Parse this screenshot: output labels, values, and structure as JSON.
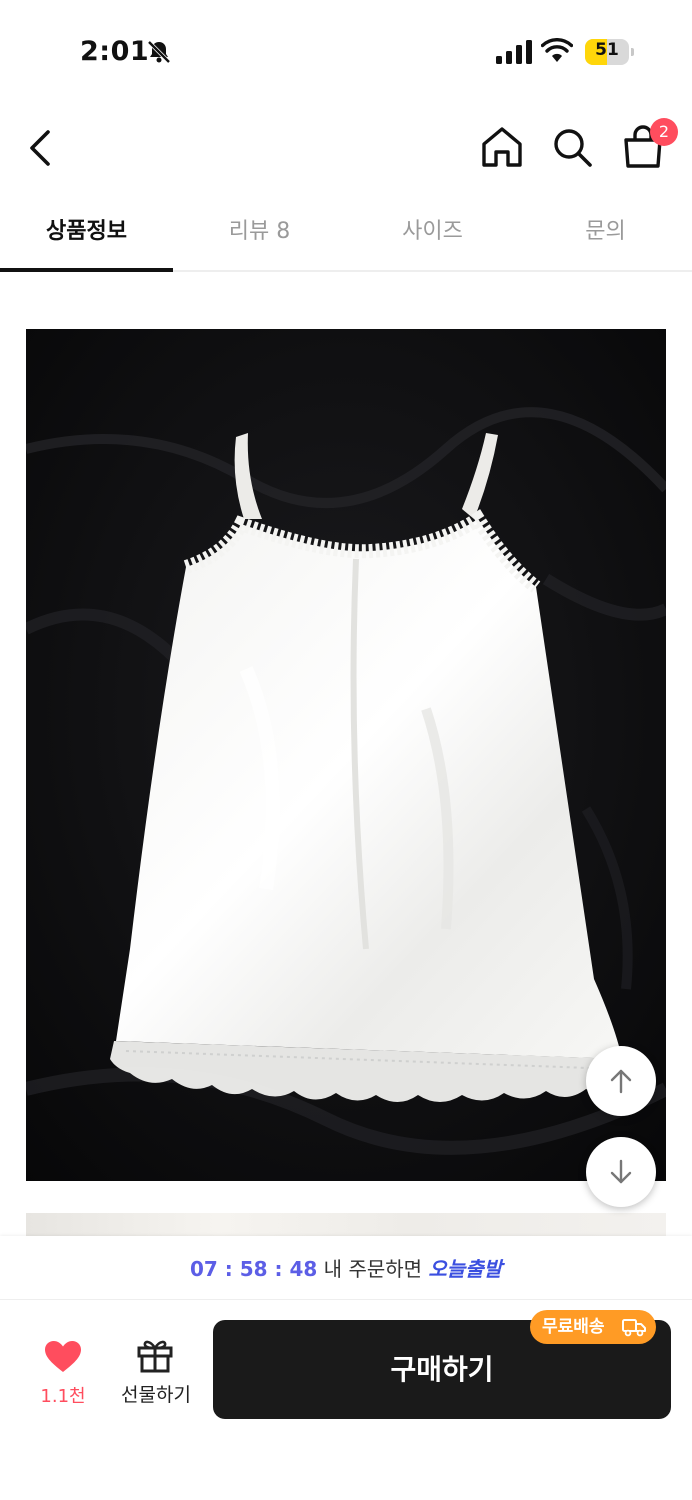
{
  "status_bar": {
    "time": "2:01",
    "battery": "51",
    "battery_level": 0.51
  },
  "header": {
    "cart_count": "2"
  },
  "tabs": [
    {
      "label": "상품정보",
      "active": true
    },
    {
      "label": "리뷰 8",
      "active": false
    },
    {
      "label": "사이즈",
      "active": false
    },
    {
      "label": "문의",
      "active": false
    }
  ],
  "delivery": {
    "timer": "07 : 58 : 48",
    "text": " 내 주문하면 ",
    "badge": "오늘출발"
  },
  "footer": {
    "like_count": "1.1천",
    "gift_label": "선물하기",
    "buy_label": "구매하기",
    "free_shipping": "무료배송"
  },
  "colors": {
    "accent": "#5c5ee6",
    "like": "#ff4d5e",
    "badge": "#ff9b25",
    "buy_button": "#1a1a1a"
  }
}
